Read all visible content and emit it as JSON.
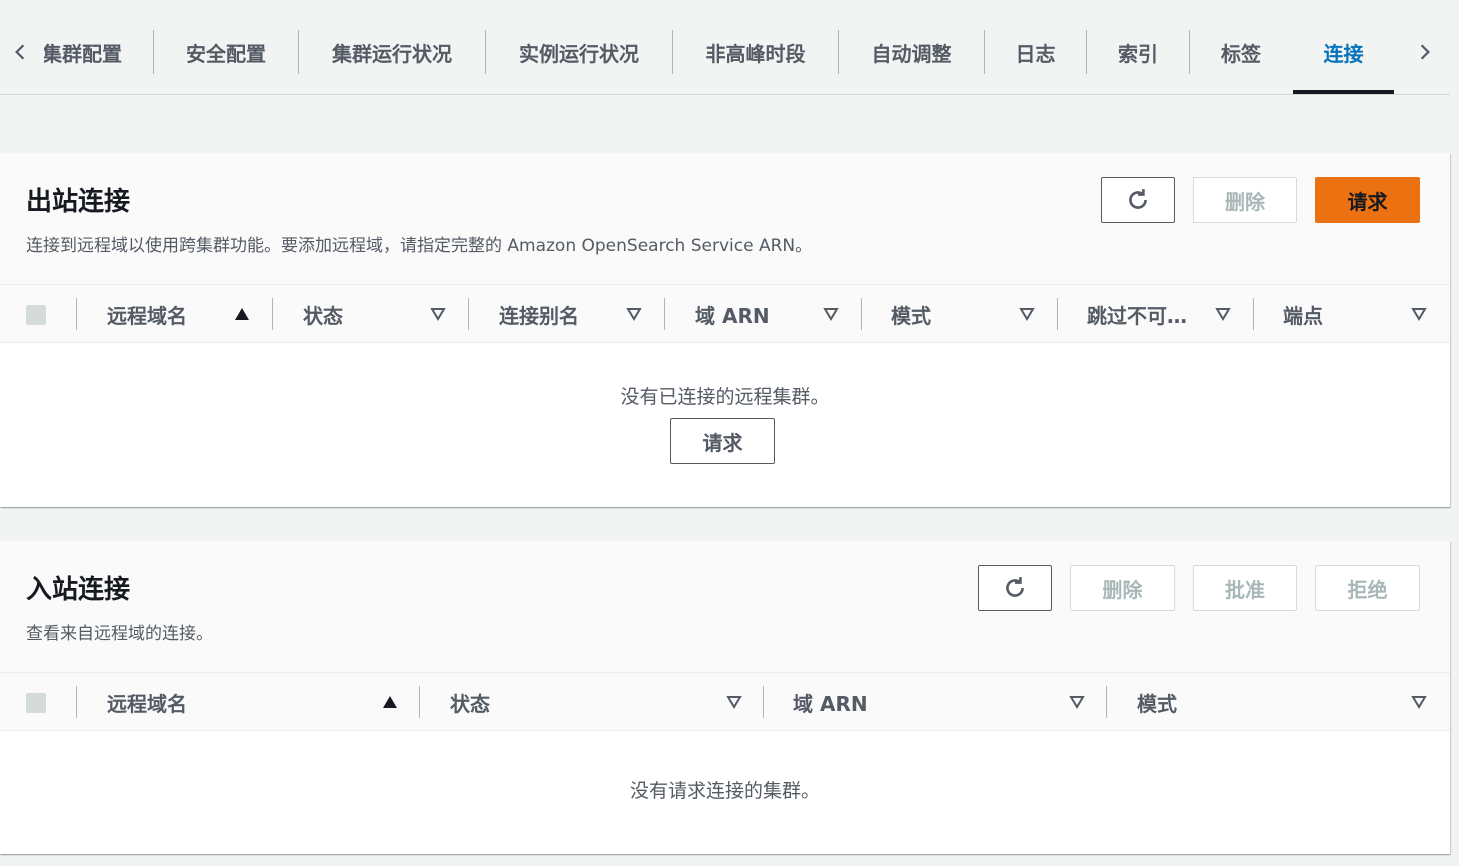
{
  "tabs": {
    "items": [
      "集群配置",
      "安全配置",
      "集群运行状况",
      "实例运行状况",
      "非高峰时段",
      "自动调整",
      "日志",
      "索引",
      "标签",
      "连接"
    ],
    "active": "连接"
  },
  "outbound": {
    "title": "出站连接",
    "description": "连接到远程域以使用跨集群功能。要添加远程域，请指定完整的 Amazon OpenSearch Service ARN。",
    "delete_label": "删除",
    "request_label": "请求",
    "columns": [
      "远程域名",
      "状态",
      "连接别名",
      "域 ARN",
      "模式",
      "跳过不可…",
      "端点"
    ],
    "empty_text": "没有已连接的远程集群。",
    "empty_button": "请求"
  },
  "inbound": {
    "title": "入站连接",
    "description": "查看来自远程域的连接。",
    "delete_label": "删除",
    "approve_label": "批准",
    "reject_label": "拒绝",
    "columns": [
      "远程域名",
      "状态",
      "域 ARN",
      "模式"
    ],
    "empty_text": "没有请求连接的集群。"
  },
  "colors": {
    "accent": "#0073bb",
    "primary_button": "#ec7211",
    "text": "#16191f",
    "muted_text": "#545b64",
    "disabled": "#aab7b8"
  },
  "icons": [
    "chevron-left-icon",
    "chevron-right-icon",
    "refresh-icon",
    "sort-ascending-icon",
    "sort-descending-icon"
  ]
}
